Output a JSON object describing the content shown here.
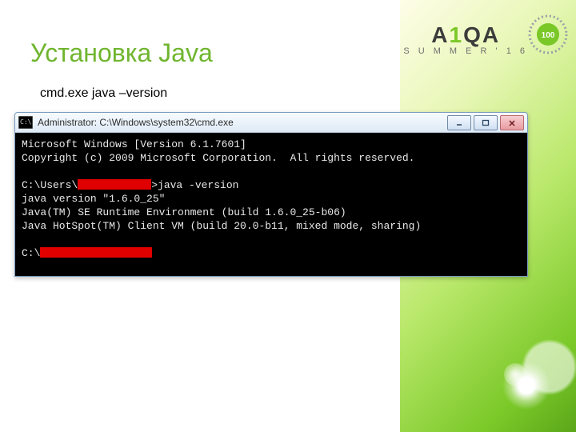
{
  "logo": {
    "middle": "1",
    "sub": "S U M M E R ' 1 6"
  },
  "title": "Установка Java",
  "command": "cmd.exe java  –version",
  "console": {
    "windowTitle": "Administrator: C:\\Windows\\system32\\cmd.exe",
    "promptPrefix": "C:\\Users\\",
    "promptCmd": ">java -version",
    "prompt2": "C:\\",
    "lines": [
      "Microsoft Windows [Version 6.1.7601]",
      "Copyright (c) 2009 Microsoft Corporation.  All rights reserved.",
      "java version \"1.6.0_25\"",
      "Java(TM) SE Runtime Environment (build 1.6.0_25-b06)",
      "Java HotSpot(TM) Client VM (build 20.0-b11, mixed mode, sharing)"
    ]
  }
}
